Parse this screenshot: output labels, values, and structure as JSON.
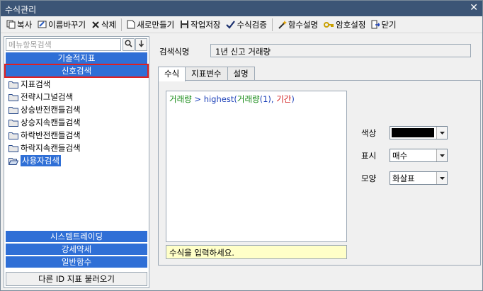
{
  "window": {
    "title": "수식관리",
    "close": "✕"
  },
  "toolbar": {
    "copy": "복사",
    "rename": "이름바꾸기",
    "delete": "삭제",
    "new": "새로만들기",
    "save": "작업저장",
    "verify": "수식검증",
    "func_help": "함수설명",
    "password": "암호설정",
    "close": "닫기"
  },
  "left": {
    "search_placeholder": "메뉴항목검색",
    "categories_top": [
      "기술적지표",
      "신호검색"
    ],
    "tree": [
      "지표검색",
      "전략시그널검색",
      "상승반전캔들검색",
      "상승지속캔들검색",
      "하락반전캔들검색",
      "하락지속캔들검색",
      "사용자검색"
    ],
    "categories_bottom": [
      "시스템트레이딩",
      "강세약세",
      "일반함수"
    ],
    "load_button": "다른 ID 지표 불러오기"
  },
  "right": {
    "name_label": "검색식명",
    "name_value": "1년 신고 거래량",
    "tabs": [
      "수식",
      "지표변수",
      "설명"
    ],
    "formula": {
      "part1": "거래량",
      "part2": " > ",
      "part3": "highest",
      "part4": "(",
      "part5": "거래량",
      "part6": "(1), ",
      "part7": "기간",
      "part8": ")"
    },
    "hint": "수식을 입력하세요.",
    "props": {
      "color_label": "색상",
      "color_value": "#000000",
      "display_label": "표시",
      "display_value": "매수",
      "shape_label": "모양",
      "shape_value": "화살표"
    }
  }
}
